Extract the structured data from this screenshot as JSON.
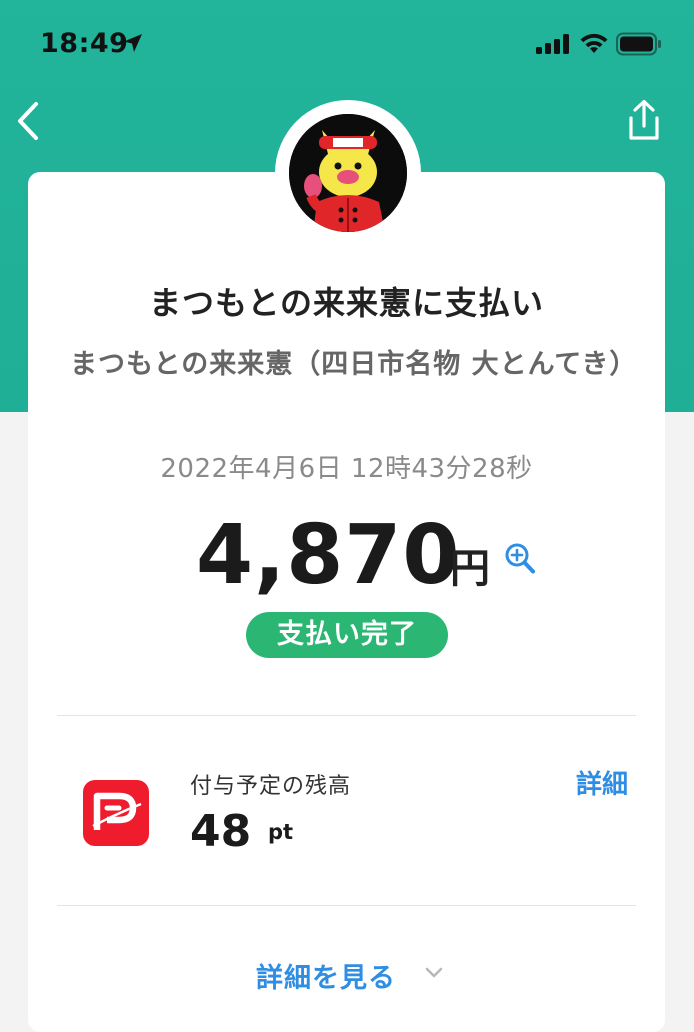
{
  "status_bar": {
    "time": "18:49"
  },
  "header": {
    "back_icon": "chevron-left-icon",
    "share_icon": "share-icon"
  },
  "payment": {
    "title": "まつもとの来来憲に支払い",
    "store_name": "まつもとの来来憲（四日市名物 大とんてき）",
    "datetime": "2022年4月6日 12時43分28秒",
    "amount": "4,870",
    "currency": "円",
    "status": "支払い完了"
  },
  "points": {
    "label": "付与予定の残高",
    "value": "48",
    "unit": "pt",
    "details_link": "詳細"
  },
  "footer": {
    "see_more": "詳細を見る"
  },
  "colors": {
    "header_green": "#22b59b",
    "status_badge": "#2bb673",
    "link_blue": "#2f8de4",
    "paypay_red": "#ef1c2d"
  }
}
